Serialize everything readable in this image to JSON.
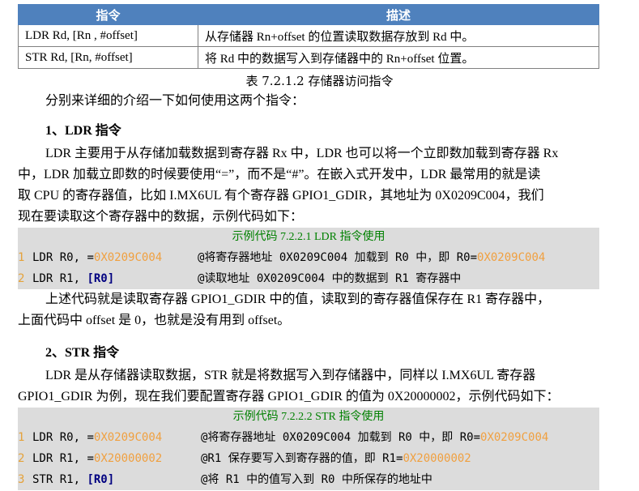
{
  "table": {
    "headers": [
      "指令",
      "描述"
    ],
    "rows": [
      [
        "LDR Rd, [Rn , #offset]",
        "从存储器 Rn+offset 的位置读取数据存放到 Rd 中。"
      ],
      [
        "STR Rd, [Rn, #offset]",
        "将 Rd 中的数据写入到存储器中的 Rn+offset 位置。"
      ]
    ],
    "caption": "表 7.2.1.2 存储器访问指令"
  },
  "intro": "分别来详细的介绍一下如何使用这两个指令：",
  "section1": {
    "heading": "1、LDR 指令",
    "para1_lines": [
      "LDR 主要用于从存储加载数据到寄存器 Rx 中，LDR 也可以将一个立即数加载到寄存器 Rx",
      "中，LDR 加载立即数的时候要使用“=”，而不是“#”。在嵌入式开发中，LDR 最常用的就是读",
      "取 CPU 的寄存器值，比如 I.MX6UL 有个寄存器 GPIO1_GDIR，其地址为 0X0209C004，我们",
      "现在要读取这个寄存器中的数据，示例代码如下："
    ],
    "code_title": "示例代码 7.2.2.1   LDR 指令使用",
    "code": [
      {
        "n": "1",
        "op": "LDR",
        "args": "R0, =",
        "num": "0X0209C004",
        "comment_a": "@将寄存器地址 0X0209C004 加载到 R0 中，即 R0=",
        "comment_num": "0X0209C004"
      },
      {
        "n": "2",
        "op": "LDR",
        "args": "R1, ",
        "br": "[R0]",
        "comment_a": "@读取地址 0X0209C004 中的数据到 R1 寄存器中"
      }
    ],
    "para2_lines": [
      "上述代码就是读取寄存器 GPIO1_GDIR 中的值，读取到的寄存器值保存在 R1 寄存器中，",
      "上面代码中 offset 是 0，也就是没有用到 offset。"
    ]
  },
  "section2": {
    "heading": "2、STR 指令",
    "para1_lines": [
      "LDR 是从存储器读取数据，STR 就是将数据写入到存储器中，同样以 I.MX6UL 寄存器",
      "GPIO1_GDIR 为例，现在我们要配置寄存器 GPIO1_GDIR 的值为 0X20000002，示例代码如下："
    ],
    "code_title": "示例代码 7.2.2.2   STR 指令使用",
    "code": [
      {
        "n": "1",
        "op": "LDR",
        "args": "R0, =",
        "num": "0X0209C004",
        "comment_a": "@将寄存器地址 0X0209C004 加载到 R0 中，即 R0=",
        "comment_num": "0X0209C004"
      },
      {
        "n": "2",
        "op": "LDR",
        "args": "R1, =",
        "num": "0X20000002",
        "comment_a": "@R1 保存要写入到寄存器的值，即 R1=",
        "comment_num": "0X20000002"
      },
      {
        "n": "3",
        "op": "STR",
        "args": "R1, ",
        "br": "[R0]",
        "comment_a": "@将 R1 中的值写入到 R0 中所保存的地址中"
      }
    ]
  }
}
